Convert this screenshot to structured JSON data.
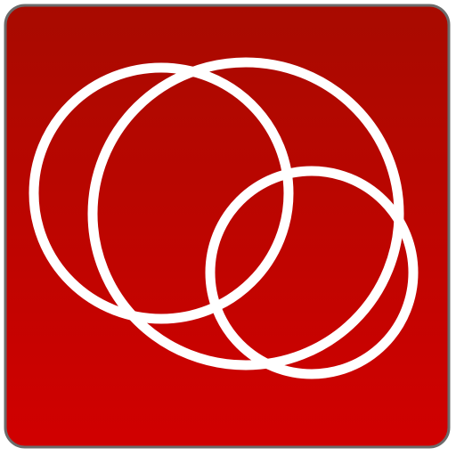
{
  "icon": {
    "name": "overlapping-rings-logo-icon",
    "colors": {
      "tile_top": "#a80a00",
      "tile_bottom": "#d10000",
      "tile_border": "#6b6b6b",
      "ring_stroke": "#ffffff",
      "page_background": "#ffffff"
    }
  }
}
